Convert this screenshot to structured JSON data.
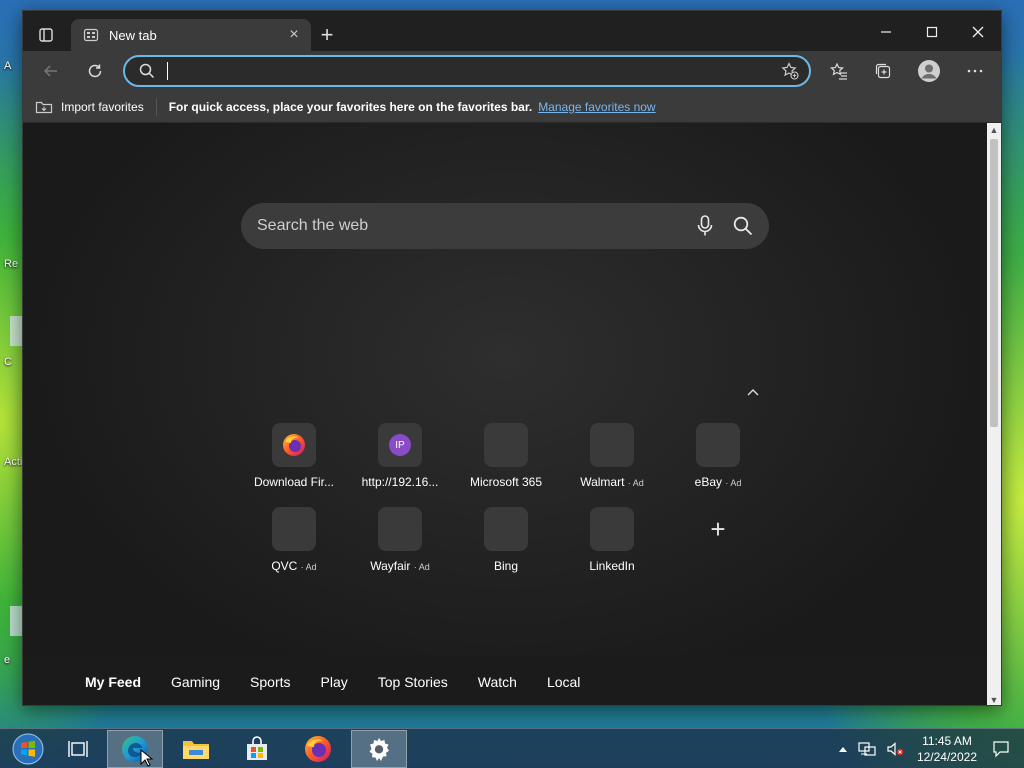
{
  "desktop": {
    "icon_labels": [
      "A",
      "Re",
      "C",
      "Acti",
      "e"
    ]
  },
  "browser": {
    "tab": {
      "title": "New tab",
      "close_glyph": "×"
    },
    "new_tab_glyph": "+",
    "address": {
      "value": "",
      "placeholder": ""
    },
    "favorites_bar": {
      "import_label": "Import favorites",
      "message": "For quick access, place your favorites here on the favorites bar.",
      "manage_link": "Manage favorites now"
    }
  },
  "ntp": {
    "search_placeholder": "Search the web",
    "tiles": [
      {
        "label": "Download Fir...",
        "ad": ""
      },
      {
        "label": "http://192.16...",
        "ad": "",
        "badge": "IP"
      },
      {
        "label": "Microsoft 365",
        "ad": ""
      },
      {
        "label": "Walmart",
        "ad": "· Ad"
      },
      {
        "label": "eBay",
        "ad": "· Ad"
      },
      {
        "label": "QVC",
        "ad": "· Ad"
      },
      {
        "label": "Wayfair",
        "ad": "· Ad"
      },
      {
        "label": "Bing",
        "ad": ""
      },
      {
        "label": "LinkedIn",
        "ad": ""
      }
    ],
    "add_glyph": "+",
    "feed_nav": [
      "My Feed",
      "Gaming",
      "Sports",
      "Play",
      "Top Stories",
      "Watch",
      "Local"
    ]
  },
  "taskbar": {
    "time": "11:45 AM",
    "date": "12/24/2022"
  },
  "colors": {
    "accent": "#6cb8e6",
    "link": "#78b5f0",
    "tile_bg": "#3a3a3a",
    "ip_badge": "#8a4bc7"
  }
}
